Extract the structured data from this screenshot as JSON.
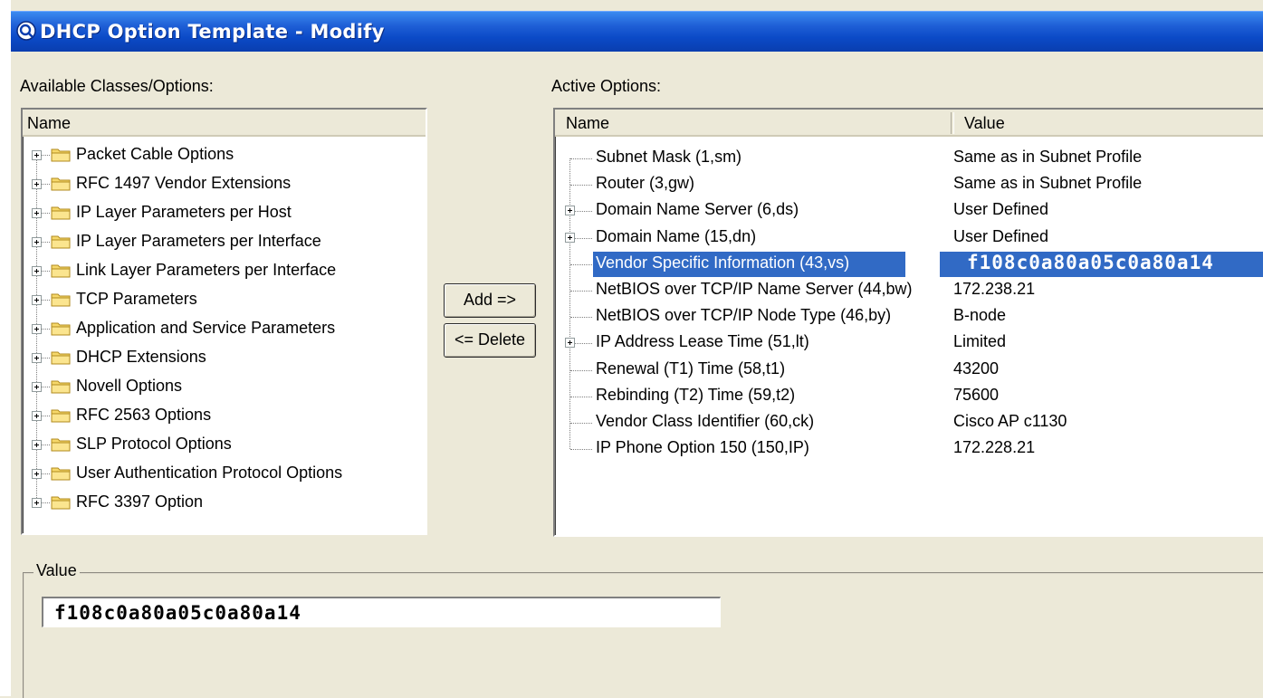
{
  "window": {
    "title": "DHCP Option Template - Modify"
  },
  "available": {
    "label": "Available Classes/Options:",
    "column_name": "Name",
    "items": [
      "Packet Cable Options",
      "RFC 1497 Vendor Extensions",
      "IP Layer Parameters per Host",
      "IP Layer Parameters per Interface",
      "Link Layer Parameters per Interface",
      "TCP Parameters",
      "Application and Service Parameters",
      "DHCP Extensions",
      "Novell Options",
      "RFC 2563 Options",
      "SLP Protocol Options",
      "User Authentication Protocol Options",
      "RFC 3397 Option"
    ]
  },
  "buttons": {
    "add": "Add =>",
    "delete": "<= Delete"
  },
  "active": {
    "label": "Active Options:",
    "column_name": "Name",
    "column_value": "Value",
    "rows": [
      {
        "name": "Subnet Mask (1,sm)",
        "value": "Same as in Subnet Profile",
        "expandable": false,
        "selected": false
      },
      {
        "name": "Router (3,gw)",
        "value": "Same as in Subnet Profile",
        "expandable": false,
        "selected": false
      },
      {
        "name": "Domain Name Server (6,ds)",
        "value": "User Defined",
        "expandable": true,
        "selected": false
      },
      {
        "name": "Domain Name (15,dn)",
        "value": "User Defined",
        "expandable": true,
        "selected": false
      },
      {
        "name": "Vendor Specific Information (43,vs)",
        "value": "f108c0a80a05c0a80a14",
        "expandable": false,
        "selected": true
      },
      {
        "name": "NetBIOS over TCP/IP Name Server (44,bw)",
        "value": "172.238.21",
        "expandable": false,
        "selected": false
      },
      {
        "name": "NetBIOS over TCP/IP Node Type (46,by)",
        "value": "B-node",
        "expandable": false,
        "selected": false
      },
      {
        "name": "IP Address Lease Time (51,lt)",
        "value": "Limited",
        "expandable": true,
        "selected": false
      },
      {
        "name": "Renewal (T1) Time (58,t1)",
        "value": "43200",
        "expandable": false,
        "selected": false
      },
      {
        "name": "Rebinding (T2) Time (59,t2)",
        "value": "75600",
        "expandable": false,
        "selected": false
      },
      {
        "name": "Vendor Class Identifier (60,ck)",
        "value": "Cisco AP c1130",
        "expandable": false,
        "selected": false
      },
      {
        "name": "IP Phone Option 150 (150,IP)",
        "value": "172.228.21",
        "expandable": false,
        "selected": false
      }
    ]
  },
  "value_group": {
    "label": "Value",
    "field_value": "f108c0a80a05c0a80a14"
  },
  "colors": {
    "title_bar": "#0b4ac7",
    "selection": "#316ac5",
    "dialog_bg": "#ece9d8"
  }
}
